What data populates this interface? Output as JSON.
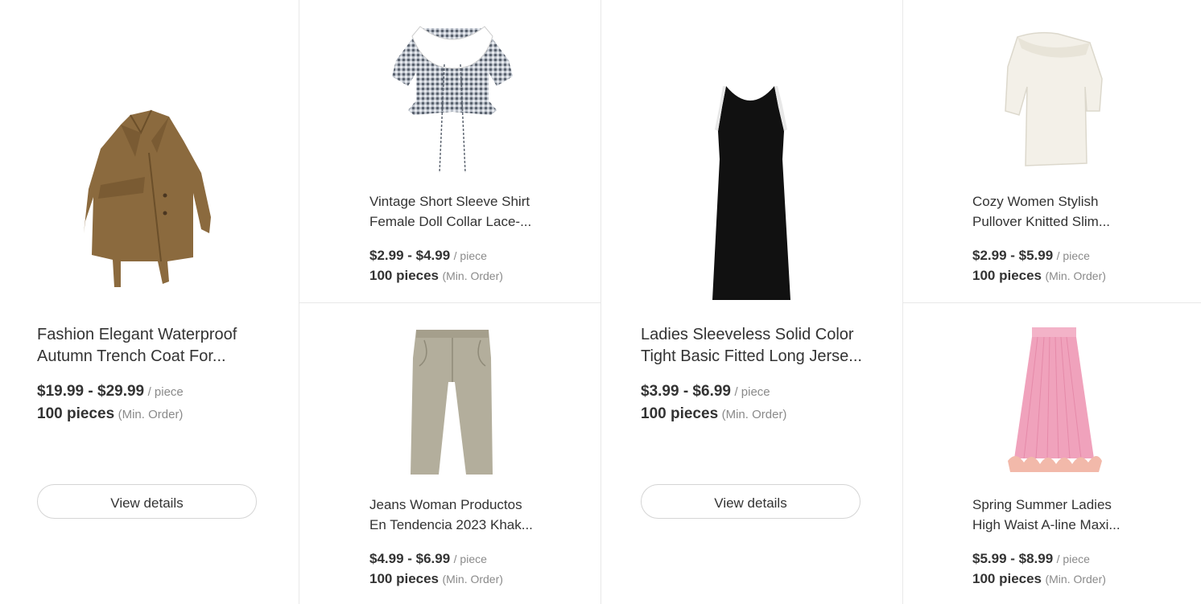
{
  "products": [
    {
      "title_line1": "Fashion Elegant Waterproof",
      "title_line2": "Autumn Trench Coat For...",
      "price": "$19.99 - $29.99",
      "unit": "/ piece",
      "moq": "100 pieces",
      "moq_label": "(Min. Order)",
      "button": "View details",
      "image_icon": "trench-coat-icon",
      "image_color": "#8b6a3e"
    },
    {
      "title_line1": "Vintage Short Sleeve Shirt",
      "title_line2": "Female Doll Collar Lace-...",
      "price": "$2.99 - $4.99",
      "unit": "/ piece",
      "moq": "100 pieces",
      "moq_label": "(Min. Order)",
      "image_icon": "gingham-blouse-icon",
      "image_color": "#7d8590"
    },
    {
      "title_line1": "Jeans Woman Productos",
      "title_line2": "En Tendencia 2023 Khak...",
      "price": "$4.99 - $6.99",
      "unit": "/ piece",
      "moq": "100 pieces",
      "moq_label": "(Min. Order)",
      "image_icon": "khaki-jeans-icon",
      "image_color": "#b3ae9c"
    },
    {
      "title_line1": "Ladies Sleeveless Solid Color",
      "title_line2": "Tight Basic Fitted Long Jerse...",
      "price": "$3.99 - $6.99",
      "unit": "/ piece",
      "moq": "100 pieces",
      "moq_label": "(Min. Order)",
      "button": "View details",
      "image_icon": "black-dress-icon",
      "image_color": "#111111"
    },
    {
      "title_line1": "Cozy Women Stylish",
      "title_line2": "Pullover Knitted Slim...",
      "price": "$2.99 - $5.99",
      "unit": "/ piece",
      "moq": "100 pieces",
      "moq_label": "(Min. Order)",
      "image_icon": "knit-top-icon",
      "image_color": "#f3f0e8"
    },
    {
      "title_line1": "Spring Summer Ladies",
      "title_line2": "High Waist A-line Maxi...",
      "price": "$5.99 - $8.99",
      "unit": "/ piece",
      "moq": "100 pieces",
      "moq_label": "(Min. Order)",
      "image_icon": "pink-pleated-skirt-icon",
      "image_color": "#f0a2bc"
    }
  ]
}
